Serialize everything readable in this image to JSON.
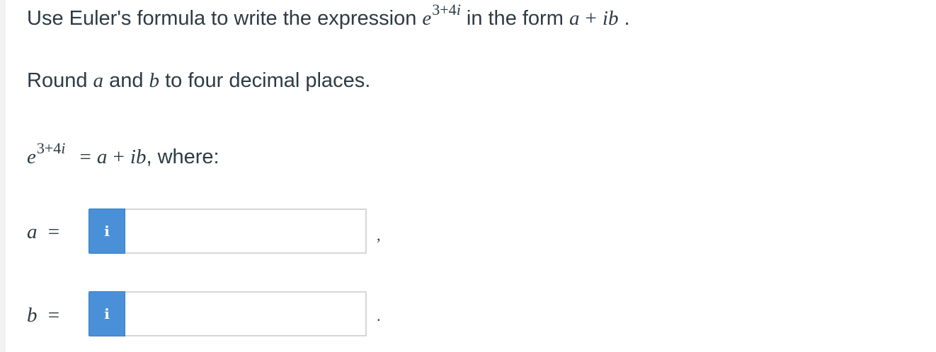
{
  "question": {
    "prefix": "Use Euler's formula to write the expression",
    "expr_base": "e",
    "expr_exp_num": "3+4",
    "expr_exp_var": "i",
    "mid": "in the form",
    "form_a": "a",
    "form_plus": "+",
    "form_ib": "ib",
    "end": "."
  },
  "instruction": {
    "prefix": "Round",
    "var_a": "a",
    "and": "and",
    "var_b": "b",
    "suffix": "to four decimal places."
  },
  "equation": {
    "base": "e",
    "exp_num": "3+4",
    "exp_var": "i",
    "equals": "=",
    "a": "a",
    "plus": "+",
    "ib": "ib",
    "suffix": ", where:"
  },
  "answers": [
    {
      "var": "a",
      "equals": "=",
      "info_glyph": "i",
      "value": "",
      "placeholder": "",
      "punct": ","
    },
    {
      "var": "b",
      "equals": "=",
      "info_glyph": "i",
      "value": "",
      "placeholder": "",
      "punct": "."
    }
  ],
  "colors": {
    "text": "#2d3b45",
    "info_button": "#4a90d9",
    "input_border": "#d6d6d6"
  }
}
